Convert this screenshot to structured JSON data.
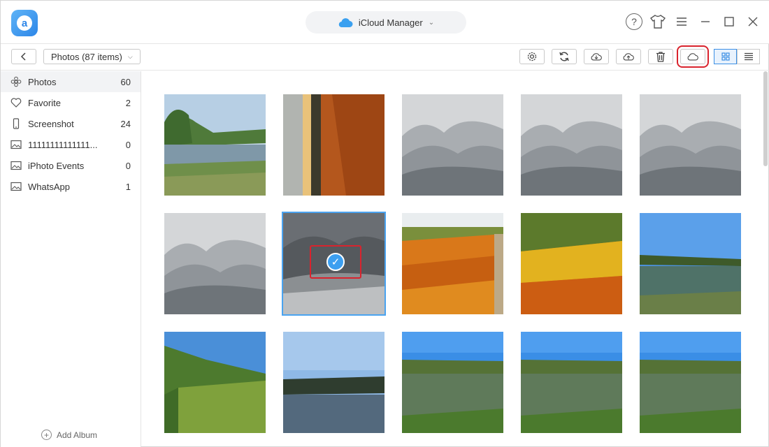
{
  "app": {
    "manager_label": "iCloud Manager"
  },
  "toolbar": {
    "album_label": "Photos (87 items)"
  },
  "sidebar": {
    "items": [
      {
        "label": "Photos",
        "count": "60",
        "icon": "flower-icon"
      },
      {
        "label": "Favorite",
        "count": "2",
        "icon": "heart-icon"
      },
      {
        "label": "Screenshot",
        "count": "24",
        "icon": "phone-icon"
      },
      {
        "label": "11111111111111...",
        "count": "0",
        "icon": "image-icon"
      },
      {
        "label": "iPhoto Events",
        "count": "0",
        "icon": "image-icon"
      },
      {
        "label": "WhatsApp",
        "count": "1",
        "icon": "image-icon"
      }
    ],
    "add_album": "Add Album"
  },
  "photos": [
    {
      "scene": "lake-park"
    },
    {
      "scene": "sunset-field"
    },
    {
      "scene": "snow-trees"
    },
    {
      "scene": "snow-trees"
    },
    {
      "scene": "snow-trees"
    },
    {
      "scene": "snow-trees"
    },
    {
      "scene": "snow-dark",
      "selected": true
    },
    {
      "scene": "marigolds"
    },
    {
      "scene": "marigolds-bright"
    },
    {
      "scene": "lake-reeds"
    },
    {
      "scene": "lake-green"
    },
    {
      "scene": "lake-treeline"
    },
    {
      "scene": "lake-blue"
    },
    {
      "scene": "lake-blue"
    },
    {
      "scene": "lake-blue"
    }
  ]
}
